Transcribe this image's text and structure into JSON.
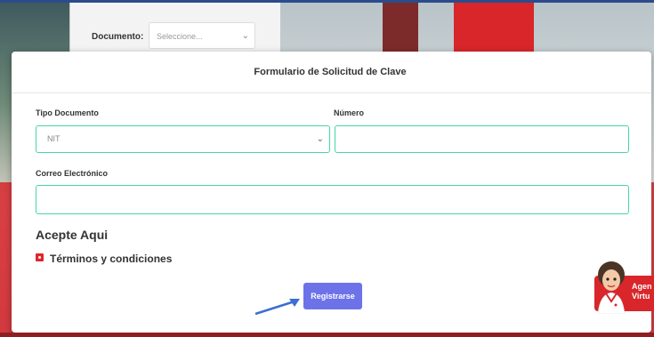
{
  "background": {
    "document_label": "Documento:",
    "document_select": "Seleccione..."
  },
  "modal": {
    "title": "Formulario de Solicitud de Clave",
    "tipo_documento_label": "Tipo Documento",
    "tipo_documento_value": "NIT",
    "numero_label": "Número",
    "numero_value": "",
    "correo_label": "Correo Electrónico",
    "correo_value": "",
    "acepte_heading": "Acepte Aqui",
    "terms_label": "Términos y condiciones",
    "submit_label": "Registrarse"
  },
  "agent": {
    "line1": "Agen",
    "line2": "Virtu"
  },
  "colors": {
    "accent_field": "#46d6a8",
    "button": "#6d72e8",
    "brand_red": "#d8262b"
  }
}
